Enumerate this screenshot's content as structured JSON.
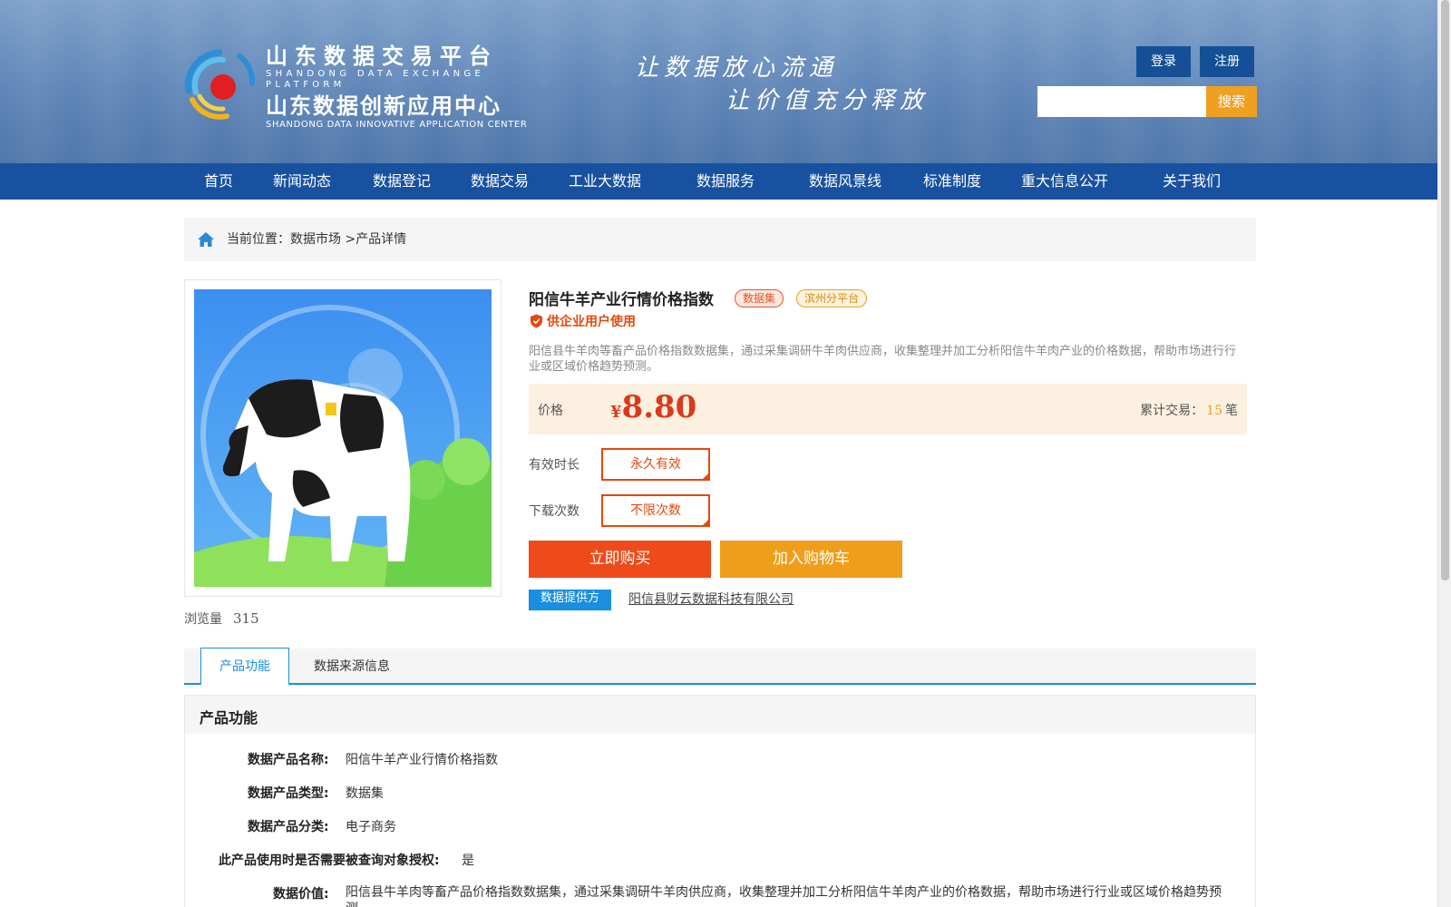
{
  "header": {
    "logo": {
      "name_cn": "山东数据交易平台",
      "name_en": "SHANDONG DATA EXCHANGE PLATFORM",
      "center_cn": "山东数据创新应用中心",
      "center_en": "SHANDONG DATA INNOVATIVE APPLICATION CENTER"
    },
    "slogan_line1": "让数据放心流通",
    "slogan_line2": "让价值充分释放",
    "login_label": "登录",
    "register_label": "注册",
    "search": {
      "value": "",
      "placeholder": "",
      "button_label": "搜索"
    }
  },
  "nav": {
    "items": [
      {
        "label": "首页"
      },
      {
        "label": "新闻动态"
      },
      {
        "label": "数据登记"
      },
      {
        "label": "数据交易"
      },
      {
        "label": "工业大数据"
      },
      {
        "label": "数据服务"
      },
      {
        "label": "数据风景线"
      },
      {
        "label": "标准制度"
      },
      {
        "label": "重大信息公开"
      },
      {
        "label": "关于我们"
      }
    ]
  },
  "breadcrumb": {
    "prefix": "当前位置：",
    "level1": "数据市场",
    "separator": ">",
    "level2": "产品详情"
  },
  "product": {
    "views_label": "浏览量",
    "views_count": "315",
    "title": "阳信牛羊产业行情价格指数",
    "tag_type": "数据集",
    "tag_platform": "滨州分平台",
    "usage_note": "供企业用户使用",
    "description": "阳信县牛羊肉等畜产品价格指数数据集，通过采集调研牛羊肉供应商，收集整理并加工分析阳信牛羊肉产业的价格数据，帮助市场进行行业或区域价格趋势预测。",
    "price_label": "价格",
    "currency": "¥",
    "price": "8.80",
    "trade_label": "累计交易：",
    "trade_count": "15",
    "trade_unit": "笔",
    "validity_label": "有效时长",
    "validity_value": "永久有效",
    "downloads_label": "下载次数",
    "downloads_value": "不限次数",
    "buy_label": "立即购买",
    "cart_label": "加入购物车",
    "provider_tag": "数据提供方",
    "provider_name": "阳信县财云数据科技有限公司"
  },
  "tabs": [
    {
      "label": "产品功能",
      "active": true
    },
    {
      "label": "数据来源信息",
      "active": false
    }
  ],
  "function_section": {
    "title": "产品功能",
    "rows": [
      {
        "label": "数据产品名称:",
        "value": "阳信牛羊产业行情价格指数"
      },
      {
        "label": "数据产品类型:",
        "value": "数据集"
      },
      {
        "label": "数据产品分类:",
        "value": "电子商务"
      },
      {
        "label": "此产品使用时是否需要被查询对象授权:",
        "value": "是"
      },
      {
        "label": "数据价值:",
        "value": "阳信县牛羊肉等畜产品价格指数数据集，通过采集调研牛羊肉供应商，收集整理并加工分析阳信牛羊肉产业的价格数据，帮助市场进行行业或区域价格趋势预测。"
      }
    ]
  },
  "colors": {
    "nav_bg": "#1751a0",
    "accent_orange": "#ef4a19",
    "accent_yellow": "#ef9e1c",
    "link_blue": "#1a8fe0",
    "price_red": "#d93a1c"
  }
}
